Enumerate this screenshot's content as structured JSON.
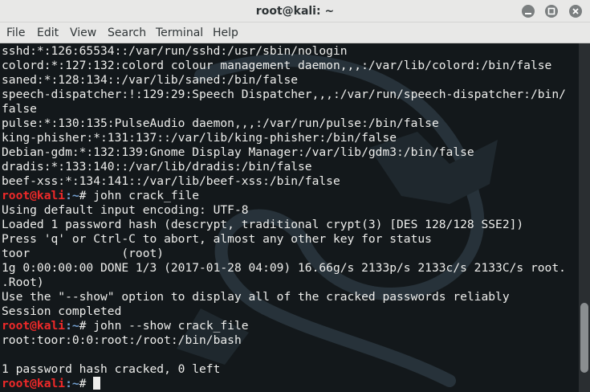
{
  "window": {
    "title": "root@kali: ~"
  },
  "menu": [
    "File",
    "Edit",
    "View",
    "Search",
    "Terminal",
    "Help"
  ],
  "terminal": {
    "lines": [
      "sshd:*:126:65534::/var/run/sshd:/usr/sbin/nologin",
      "colord:*:127:132:colord colour management daemon,,,:/var/lib/colord:/bin/false",
      "saned:*:128:134::/var/lib/saned:/bin/false",
      "speech-dispatcher:!:129:29:Speech Dispatcher,,,:/var/run/speech-dispatcher:/bin/",
      "false",
      "pulse:*:130:135:PulseAudio daemon,,,:/var/run/pulse:/bin/false",
      "king-phisher:*:131:137::/var/lib/king-phisher:/bin/false",
      "Debian-gdm:*:132:139:Gnome Display Manager:/var/lib/gdm3:/bin/false",
      "dradis:*:133:140::/var/lib/dradis:/bin/false",
      "beef-xss:*:134:141::/var/lib/beef-xss:/bin/false",
      {
        "prompt": "root@kali",
        "path": ":~",
        "symbol": "# ",
        "command": "john crack_file"
      },
      "Using default input encoding: UTF-8",
      "Loaded 1 password hash (descrypt, traditional crypt(3) [DES 128/128 SSE2])",
      "Press 'q' or Ctrl-C to abort, almost any other key for status",
      "toor             (root)",
      "1g 0:00:00:00 DONE 1/3 (2017-01-28 04:09) 16.66g/s 2133p/s 2133c/s 2133C/s root.",
      ".Root)",
      "Use the \"--show\" option to display all of the cracked passwords reliably",
      "Session completed",
      {
        "prompt": "root@kali",
        "path": ":~",
        "symbol": "# ",
        "command": "john --show crack_file"
      },
      "root:toor:0:0:root:/root:/bin/bash",
      "",
      "1 password hash cracked, 0 left",
      {
        "prompt": "root@kali",
        "path": ":~",
        "symbol": "# ",
        "command": "",
        "cursor": true
      }
    ]
  },
  "scrollbar": {
    "position": 0.93,
    "visible_fraction": 0.2
  },
  "colors": {
    "prompt": "#ef2929",
    "path": "#729fcf",
    "text": "#eeeeec",
    "background": "#13181b"
  }
}
